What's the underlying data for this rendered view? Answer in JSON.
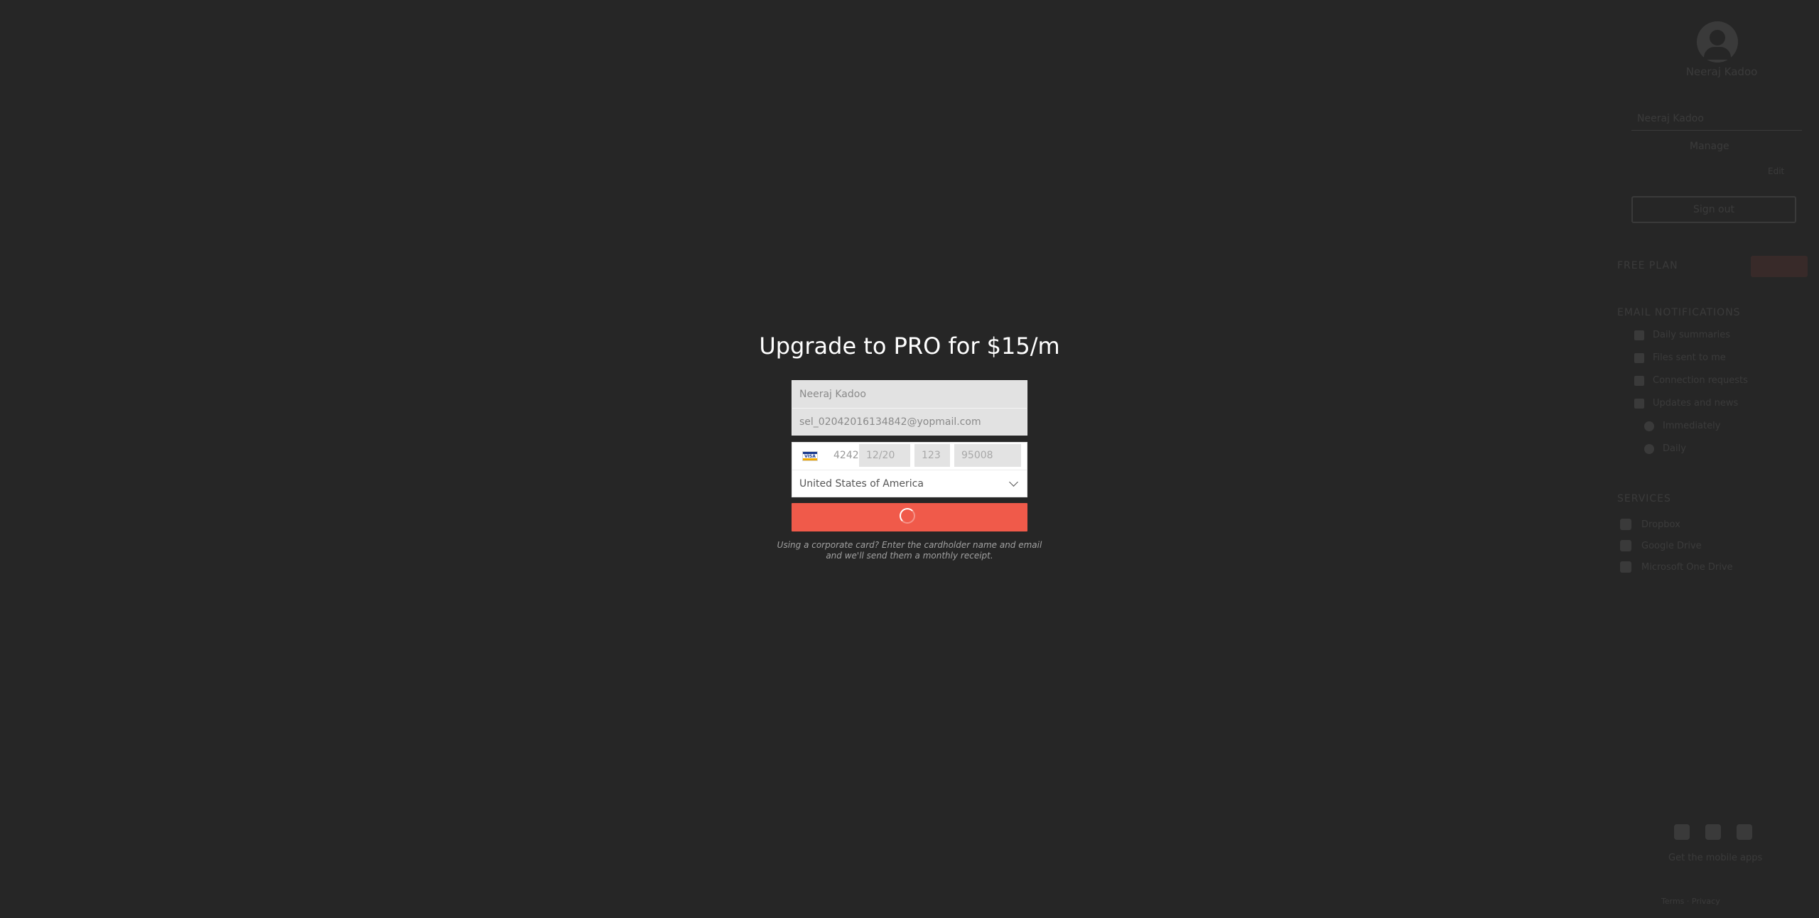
{
  "modal": {
    "title": "Upgrade to PRO for $15/m",
    "name_value": "Neeraj Kadoo",
    "email_value": "sel_02042016134842@yopmail.com",
    "card_brand_icon": "visa-icon",
    "card_number_tail": "4242",
    "card_expiry": "12/20",
    "card_cvc": "123",
    "card_zip": "95008",
    "country_value": "United States of America",
    "note_line1": "Using a corporate card? Enter the cardholder name and email",
    "note_line2": "and we'll send them a monthly receipt.",
    "accent_color": "#f05a4a"
  },
  "background_panel": {
    "user_name": "Neeraj Kadoo",
    "field_text": "Neeraj Kadoo",
    "sub_text": "Manage",
    "small_text": "Edit",
    "button_label": "Sign out",
    "plan_heading": "FREE PLAN",
    "notifications_heading": "EMAIL NOTIFICATIONS",
    "notifications": [
      "Daily summaries",
      "Files sent to me",
      "Connection requests",
      "Updates and news"
    ],
    "radios": [
      "Immediately",
      "Daily"
    ],
    "services_heading": "SERVICES",
    "services": [
      "Dropbox",
      "Google Drive",
      "Microsoft One Drive"
    ],
    "apps_label": "Get the mobile apps",
    "footer": "Terms · Privacy"
  }
}
